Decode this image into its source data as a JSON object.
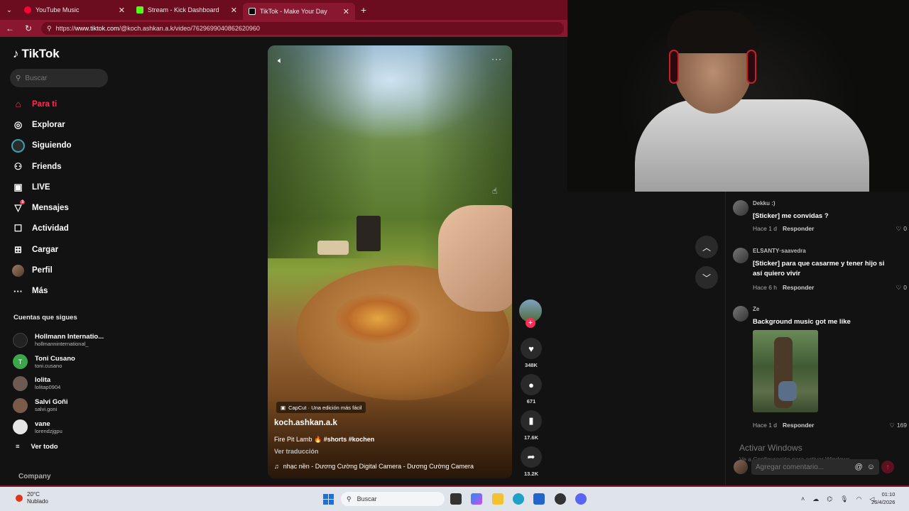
{
  "browser": {
    "tabs": [
      {
        "title": "YouTube Music",
        "color": "#ff0033"
      },
      {
        "title": "Stream - Kick Dashboard",
        "color": "#53fc18"
      },
      {
        "title": "TikTok - Make Your Day",
        "color": "#000000"
      }
    ],
    "url_prefix": "https://",
    "url_host": "www.tiktok.com",
    "url_path": "/@koch.ashkan.a.k/video/7629699040862620960"
  },
  "sidebar": {
    "logo": "TikTok",
    "search_placeholder": "Buscar",
    "nav": [
      {
        "label": "Para ti",
        "icon": "home-icon"
      },
      {
        "label": "Explorar",
        "icon": "compass-icon"
      },
      {
        "label": "Siguiendo",
        "icon": "following-icon"
      },
      {
        "label": "Friends",
        "icon": "friends-icon"
      },
      {
        "label": "LIVE",
        "icon": "live-icon"
      },
      {
        "label": "Mensajes",
        "icon": "messages-icon",
        "badge": "3"
      },
      {
        "label": "Actividad",
        "icon": "activity-icon"
      },
      {
        "label": "Cargar",
        "icon": "upload-icon"
      },
      {
        "label": "Perfil",
        "icon": "profile-avatar"
      },
      {
        "label": "Más",
        "icon": "more-icon"
      }
    ],
    "following_title": "Cuentas que sigues",
    "following": [
      {
        "name": "Hollmann Internatio...",
        "user": "hollmanninternational_",
        "initial": "",
        "color": "#222222"
      },
      {
        "name": "Toni Cusano",
        "user": "toni.cusano",
        "initial": "T",
        "color": "#3aa74a"
      },
      {
        "name": "lolita",
        "user": "lolitap0904",
        "initial": "",
        "color": "#6d5a52"
      },
      {
        "name": "Salvi Goñi",
        "user": "salvi.goni",
        "initial": "",
        "color": "#7a5b4a"
      },
      {
        "name": "vane",
        "user": "lorendzjgpu",
        "initial": "",
        "color": "#e6e6e6"
      }
    ],
    "see_all": "Ver todo",
    "company": "Company"
  },
  "video": {
    "capcut": "CapCut · Una edición más fácil",
    "author": "koch.ashkan.a.k",
    "caption_text": "Fire Pit Lamb 🔥",
    "caption_tags": "#shorts #kochen",
    "translate": "Ver traducción",
    "music": "nhạc nền - Dương Cường Digital Camera - Dương Cường Camera",
    "likes": "348K",
    "comments": "671",
    "saves": "17.6K",
    "shares": "13.2K"
  },
  "comments": [
    {
      "user": "Dekku :)",
      "text": "[Sticker] me convidas ?",
      "time": "Hace 1 d",
      "reply": "Responder",
      "likes": "0"
    },
    {
      "user": "ELSANTY·saavedra",
      "text": "[Sticker] para que casarme y tener hijo si así quiero vivir",
      "time": "Hace 6 h",
      "reply": "Responder",
      "likes": "0"
    },
    {
      "user": "Ze",
      "text": "Background music got me like",
      "time": "Hace 1 d",
      "reply": "Responder",
      "likes": "169"
    }
  ],
  "comment_input_placeholder": "Agregar comentario...",
  "windows_watermark": "Activar Windows",
  "windows_watermark_sub": "Ve a Configuración para activar Windows.",
  "taskbar": {
    "temp": "20°C",
    "weather": "Nublado",
    "search": "Buscar",
    "time": "01:10",
    "date": "26/4/2026"
  }
}
